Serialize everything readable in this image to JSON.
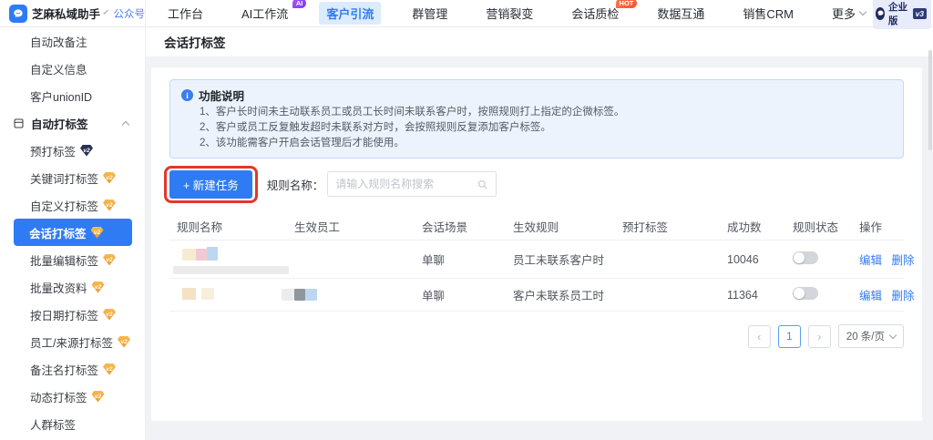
{
  "topbar": {
    "brand": "芝麻私域助手",
    "account_type": "公众号",
    "nav": [
      {
        "label": "工作台"
      },
      {
        "label": "AI工作流",
        "badge": "AI"
      },
      {
        "label": "客户引流"
      },
      {
        "label": "群管理"
      },
      {
        "label": "营销裂变"
      },
      {
        "label": "会话质检",
        "badge": "HOT"
      },
      {
        "label": "数据互通"
      },
      {
        "label": "销售CRM"
      },
      {
        "label": "更多"
      }
    ],
    "edition": {
      "label": "企业版",
      "version": "v3"
    }
  },
  "sidebar": {
    "items": [
      {
        "label": "自动改备注"
      },
      {
        "label": "自定义信息"
      },
      {
        "label": "客户unionID"
      },
      {
        "label": "自动打标签"
      },
      {
        "label": "预打标签",
        "badge": "v2"
      },
      {
        "label": "关键词打标签",
        "badge": "v2"
      },
      {
        "label": "自定义打标签",
        "badge": "v2"
      },
      {
        "label": "会话打标签",
        "badge": "v2"
      },
      {
        "label": "批量编辑标签",
        "badge": "v2"
      },
      {
        "label": "批量改资料",
        "badge": "v2"
      },
      {
        "label": "按日期打标签",
        "badge": "v2"
      },
      {
        "label": "员工/来源打标签",
        "badge": "v2"
      },
      {
        "label": "备注名打标签",
        "badge": "v2"
      },
      {
        "label": "动态打标签",
        "badge": "v2"
      },
      {
        "label": "人群标签"
      }
    ]
  },
  "page": {
    "title": "会话打标签",
    "notice": {
      "title": "功能说明",
      "lines": [
        "1、客户长时间未主动联系员工或员工长时间未联系客户时，按照规则打上指定的企微标签。",
        "2、客户或员工反复触发超时未联系对方时，会按照规则反复添加客户标签。",
        "2、该功能需客户开启会话管理后才能使用。"
      ]
    },
    "toolbar": {
      "new_task_label": "+ 新建任务",
      "filter_label": "规则名称：",
      "search_placeholder": "请输入规则名称搜索"
    },
    "table": {
      "headers": [
        "规则名称",
        "生效员工",
        "会话场景",
        "生效规则",
        "预打标签",
        "成功数",
        "规则状态",
        "操作"
      ],
      "rows": [
        {
          "scene": "单聊",
          "rule": "员工未联系客户时",
          "success_count": "10046",
          "status": "off",
          "actions": [
            "编辑",
            "删除"
          ]
        },
        {
          "scene": "单聊",
          "rule": "客户未联系员工时",
          "success_count": "11364",
          "status": "off",
          "actions": [
            "编辑",
            "删除"
          ]
        }
      ]
    },
    "pagination": {
      "prev_icon": "‹",
      "page": "1",
      "next_icon": "›",
      "page_size": "20 条/页"
    }
  },
  "colors": {
    "accent_blue": "#2f7bf3",
    "active_nav_bg": "#dcebfd",
    "hot_badge": "#ff5e2c",
    "ai_badge": "#8b3df6",
    "gem_orange": "#f0a43f",
    "gem_navy": "#2b2f55",
    "notice_bg": "#ecf3fd",
    "annotation_red": "#e2382a"
  }
}
